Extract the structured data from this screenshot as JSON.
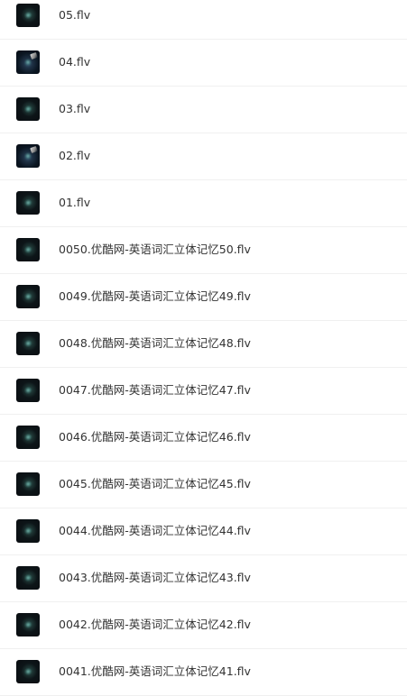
{
  "files": [
    {
      "name": "05.flv",
      "thumb": "video-thumbnail-dark"
    },
    {
      "name": "04.flv",
      "thumb": "video-thumbnail-spark"
    },
    {
      "name": "03.flv",
      "thumb": "video-thumbnail-dark"
    },
    {
      "name": "02.flv",
      "thumb": "video-thumbnail-spark"
    },
    {
      "name": "01.flv",
      "thumb": "video-thumbnail-dark"
    },
    {
      "name": "0050.优酷网-英语词汇立体记忆50.flv",
      "thumb": "video-thumbnail-dark"
    },
    {
      "name": "0049.优酷网-英语词汇立体记忆49.flv",
      "thumb": "video-thumbnail-dark"
    },
    {
      "name": "0048.优酷网-英语词汇立体记忆48.flv",
      "thumb": "video-thumbnail-dark"
    },
    {
      "name": "0047.优酷网-英语词汇立体记忆47.flv",
      "thumb": "video-thumbnail-dark"
    },
    {
      "name": "0046.优酷网-英语词汇立体记忆46.flv",
      "thumb": "video-thumbnail-dark"
    },
    {
      "name": "0045.优酷网-英语词汇立体记忆45.flv",
      "thumb": "video-thumbnail-dark"
    },
    {
      "name": "0044.优酷网-英语词汇立体记忆44.flv",
      "thumb": "video-thumbnail-dark"
    },
    {
      "name": "0043.优酷网-英语词汇立体记忆43.flv",
      "thumb": "video-thumbnail-dark"
    },
    {
      "name": "0042.优酷网-英语词汇立体记忆42.flv",
      "thumb": "video-thumbnail-dark"
    },
    {
      "name": "0041.优酷网-英语词汇立体记忆41.flv",
      "thumb": "video-thumbnail-dark"
    }
  ]
}
